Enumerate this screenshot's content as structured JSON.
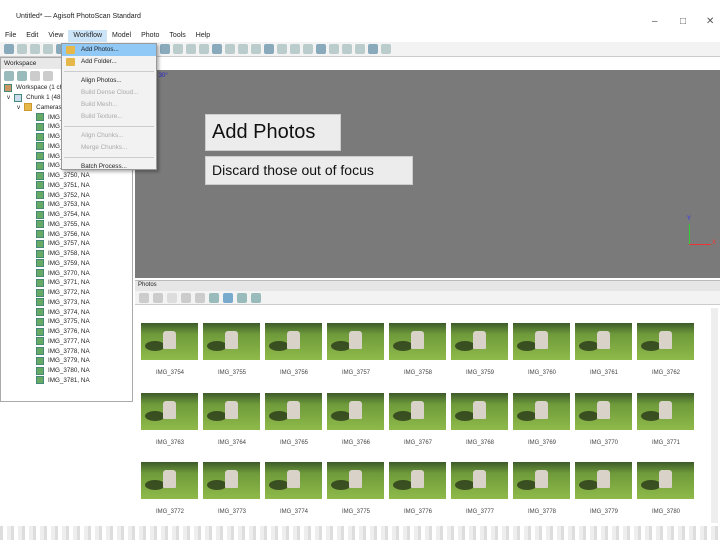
{
  "window": {
    "title": "Untitled* — Agisoft PhotoScan Standard",
    "minimize": "–",
    "maximize": "□",
    "close": "✕"
  },
  "menu": [
    "File",
    "Edit",
    "View",
    "Workflow",
    "Model",
    "Photo",
    "Tools",
    "Help"
  ],
  "workflow_menu": [
    {
      "label": "Add Photos...",
      "highlighted": true,
      "enabled": true
    },
    {
      "label": "Add Folder...",
      "enabled": true
    },
    {
      "label": "Align Photos...",
      "enabled": true
    },
    {
      "label": "Build Dense Cloud...",
      "enabled": false
    },
    {
      "label": "Build Mesh...",
      "enabled": false
    },
    {
      "label": "Build Texture...",
      "enabled": false
    },
    {
      "label": "Align Chunks...",
      "enabled": false
    },
    {
      "label": "Merge Chunks...",
      "enabled": false
    },
    {
      "label": "Batch Process...",
      "enabled": true
    }
  ],
  "workspace": {
    "header": "Workspace",
    "root": "Workspace (1 ch",
    "chunk": "Chunk 1 (48",
    "cameras": "Cameras",
    "items": [
      "IMG_",
      "IMG_",
      "IMG_",
      "IMG_",
      "IMG_",
      "IMG_",
      "IMG_3750, NA",
      "IMG_3751, NA",
      "IMG_3752, NA",
      "IMG_3753, NA",
      "IMG_3754, NA",
      "IMG_3755, NA",
      "IMG_3756, NA",
      "IMG_3757, NA",
      "IMG_3758, NA",
      "IMG_3759, NA",
      "IMG_3770, NA",
      "IMG_3771, NA",
      "IMG_3772, NA",
      "IMG_3773, NA",
      "IMG_3774, NA",
      "IMG_3775, NA",
      "IMG_3776, NA",
      "IMG_3777, NA",
      "IMG_3778, NA",
      "IMG_3779, NA",
      "IMG_3780, NA",
      "IMG_3781, NA"
    ]
  },
  "viewport": {
    "label": "spective 30°",
    "axis_y": "Y",
    "axis_x": "X"
  },
  "photos": {
    "header": "Photos",
    "thumbs": [
      "IMG_3754",
      "IMG_3755",
      "IMG_3756",
      "IMG_3757",
      "IMG_3758",
      "IMG_3759",
      "IMG_3760",
      "IMG_3761",
      "IMG_3762",
      "IMG_3763",
      "IMG_3764",
      "IMG_3765",
      "IMG_3766",
      "IMG_3767",
      "IMG_3768",
      "IMG_3769",
      "IMG_3770",
      "IMG_3771",
      "IMG_3772",
      "IMG_3773",
      "IMG_3774",
      "IMG_3775",
      "IMG_3776",
      "IMG_3777",
      "IMG_3778",
      "IMG_3779",
      "IMG_3780"
    ]
  },
  "overlay": {
    "title": "Add Photos",
    "subtitle": "Discard those out of focus"
  }
}
